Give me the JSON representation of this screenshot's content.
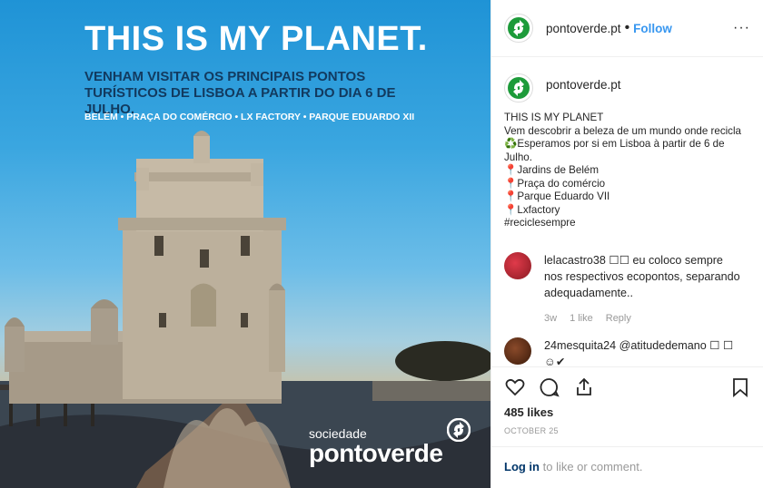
{
  "post_image": {
    "headline": "THIS IS MY PLANET.",
    "subhead": "VENHAM VISITAR OS PRINCIPAIS PONTOS TURÍSTICOS DE LISBOA A PARTIR DO DIA 6 DE JULHO.",
    "places": "BELÉM • PRAÇA DO COMÉRCIO • LX FACTORY • PARQUE EDUARDO XII",
    "brand_small": "sociedade",
    "brand_name": "pontoverde"
  },
  "header": {
    "username": "pontoverde.pt",
    "separator": "•",
    "follow_label": "Follow",
    "more_label": "···"
  },
  "caption": {
    "username": "pontoverde.pt",
    "text": "THIS IS MY PLANET\nVem descobrir a beleza de um mundo onde recicla\n♻️Esperamos por si em Lisboa à partir de 6 de Julho.\n📍Jardins de Belém\n📍Praça do comércio\n📍Parque Eduardo VII\n📍Lxfactory\n#reciclesempre"
  },
  "comments": [
    {
      "username": "lelacastro38",
      "text": "☐☐ eu coloco sempre nos respectivos ecopontos, separando adequadamente..",
      "age": "3w",
      "likes": "1 like",
      "reply_label": "Reply"
    },
    {
      "username": "24mesquita24",
      "text": "@atitudedemano ☐ ☐☺✔"
    }
  ],
  "footer": {
    "likes": "485 likes",
    "date": "OCTOBER 25",
    "login_link": "Log in",
    "login_text": " to like or comment."
  },
  "colors": {
    "brand_green": "#1d9b3a",
    "link_blue": "#3897f0"
  }
}
